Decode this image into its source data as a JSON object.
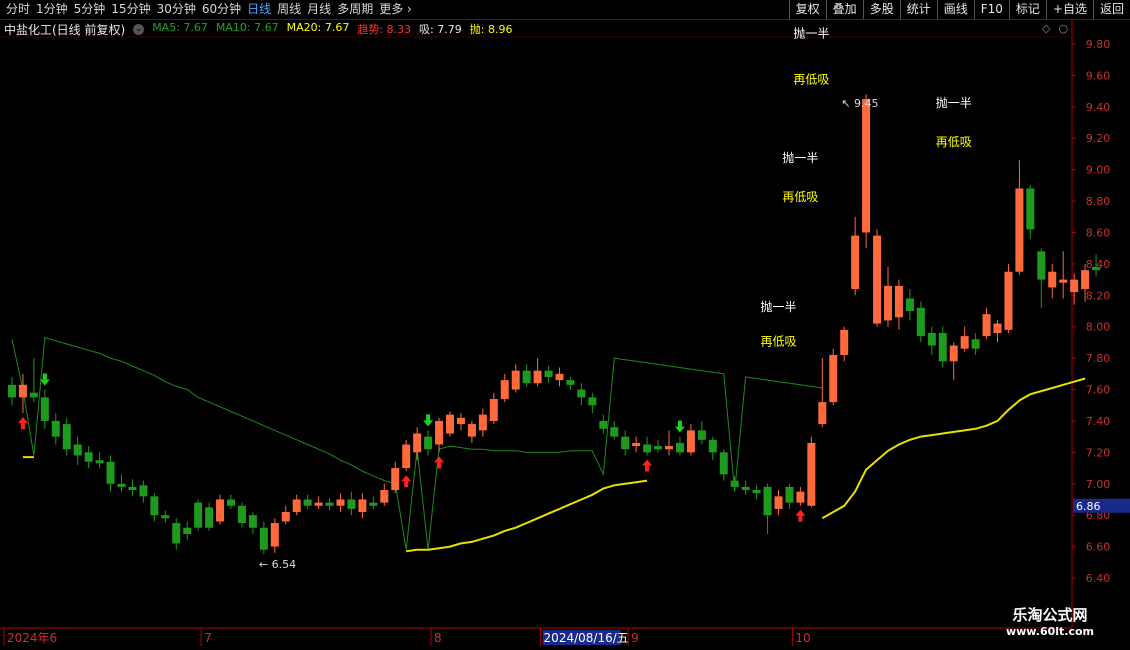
{
  "toolbar": {
    "periods": [
      {
        "label": "分时",
        "active": false
      },
      {
        "label": "1分钟",
        "active": false
      },
      {
        "label": "5分钟",
        "active": false
      },
      {
        "label": "15分钟",
        "active": false
      },
      {
        "label": "30分钟",
        "active": false
      },
      {
        "label": "60分钟",
        "active": false
      },
      {
        "label": "日线",
        "active": true
      },
      {
        "label": "周线",
        "active": false
      },
      {
        "label": "月线",
        "active": false
      },
      {
        "label": "多周期",
        "active": false
      },
      {
        "label": "更多",
        "active": false
      }
    ],
    "right_buttons": [
      "复权",
      "叠加",
      "多股",
      "统计",
      "画线",
      "F10",
      "标记",
      "+自选",
      "返回"
    ]
  },
  "infobar": {
    "title": "中盐化工(日线 前复权)",
    "indicators": [
      {
        "label": "MA5: 7.67",
        "color": "#20a020"
      },
      {
        "label": "MA10: 7.67",
        "color": "#20a020"
      },
      {
        "label": "MA20: 7.67",
        "color": "#ffff00"
      },
      {
        "label": "趋势: 8.33",
        "color": "#ff3030"
      },
      {
        "label": "吸: 7.79",
        "color": "#e8e8e8"
      },
      {
        "label": "抛: 8.96",
        "color": "#ffff00"
      }
    ]
  },
  "colors": {
    "up": "#ff6a3d",
    "down": "#1e9a1e",
    "ma20": "#e8e000",
    "green_line": "#1e8a1e",
    "axis": "#b00000",
    "last_price_bg": "#1a2a8a"
  },
  "chart_data": {
    "type": "candlestick",
    "y_ticks": [
      6.4,
      6.6,
      6.8,
      7.0,
      7.2,
      7.4,
      7.6,
      7.8,
      8.0,
      8.2,
      8.4,
      8.6,
      8.8,
      9.0,
      9.2,
      9.4,
      9.6,
      9.8
    ],
    "ylim": [
      6.3,
      9.9
    ],
    "last_price": "6.86",
    "x_labels": [
      {
        "text": "2024年6",
        "index": 0
      },
      {
        "text": "7",
        "index": 18
      },
      {
        "text": "8",
        "index": 39
      },
      {
        "text": "2024/08/16/五",
        "index": 49,
        "highlight": true
      },
      {
        "text": "9",
        "index": 57
      },
      {
        "text": "10",
        "index": 72
      }
    ],
    "candles": [
      {
        "o": 7.63,
        "c": 7.55,
        "h": 7.68,
        "l": 7.5
      },
      {
        "o": 7.55,
        "c": 7.63,
        "h": 7.7,
        "l": 7.45
      },
      {
        "o": 7.58,
        "c": 7.55,
        "h": 7.8,
        "l": 7.52
      },
      {
        "o": 7.55,
        "c": 7.4,
        "h": 7.6,
        "l": 7.35
      },
      {
        "o": 7.4,
        "c": 7.3,
        "h": 7.45,
        "l": 7.25
      },
      {
        "o": 7.38,
        "c": 7.22,
        "h": 7.42,
        "l": 7.18
      },
      {
        "o": 7.25,
        "c": 7.18,
        "h": 7.3,
        "l": 7.12
      },
      {
        "o": 7.2,
        "c": 7.14,
        "h": 7.24,
        "l": 7.1
      },
      {
        "o": 7.15,
        "c": 7.13,
        "h": 7.2,
        "l": 7.1
      },
      {
        "o": 7.14,
        "c": 7.0,
        "h": 7.18,
        "l": 6.95
      },
      {
        "o": 7.0,
        "c": 6.98,
        "h": 7.06,
        "l": 6.95
      },
      {
        "o": 6.98,
        "c": 6.96,
        "h": 7.03,
        "l": 6.92
      },
      {
        "o": 6.99,
        "c": 6.92,
        "h": 7.02,
        "l": 6.88
      },
      {
        "o": 6.92,
        "c": 6.8,
        "h": 6.94,
        "l": 6.76
      },
      {
        "o": 6.8,
        "c": 6.78,
        "h": 6.83,
        "l": 6.75
      },
      {
        "o": 6.75,
        "c": 6.62,
        "h": 6.78,
        "l": 6.58
      },
      {
        "o": 6.72,
        "c": 6.68,
        "h": 6.76,
        "l": 6.64
      },
      {
        "o": 6.88,
        "c": 6.72,
        "h": 6.9,
        "l": 6.7
      },
      {
        "o": 6.85,
        "c": 6.72,
        "h": 6.88,
        "l": 6.7
      },
      {
        "o": 6.76,
        "c": 6.9,
        "h": 6.93,
        "l": 6.74
      },
      {
        "o": 6.9,
        "c": 6.86,
        "h": 6.93,
        "l": 6.84
      },
      {
        "o": 6.86,
        "c": 6.75,
        "h": 6.88,
        "l": 6.72
      },
      {
        "o": 6.8,
        "c": 6.72,
        "h": 6.82,
        "l": 6.68
      },
      {
        "o": 6.72,
        "c": 6.58,
        "h": 6.76,
        "l": 6.55
      },
      {
        "o": 6.6,
        "c": 6.75,
        "h": 6.78,
        "l": 6.56
      },
      {
        "o": 6.76,
        "c": 6.82,
        "h": 6.86,
        "l": 6.74
      },
      {
        "o": 6.82,
        "c": 6.9,
        "h": 6.93,
        "l": 6.8
      },
      {
        "o": 6.9,
        "c": 6.86,
        "h": 6.93,
        "l": 6.84
      },
      {
        "o": 6.86,
        "c": 6.88,
        "h": 6.92,
        "l": 6.84
      },
      {
        "o": 6.88,
        "c": 6.86,
        "h": 6.91,
        "l": 6.83
      },
      {
        "o": 6.86,
        "c": 6.9,
        "h": 6.94,
        "l": 6.82
      },
      {
        "o": 6.9,
        "c": 6.84,
        "h": 6.95,
        "l": 6.8
      },
      {
        "o": 6.82,
        "c": 6.9,
        "h": 6.94,
        "l": 6.78
      },
      {
        "o": 6.88,
        "c": 6.86,
        "h": 6.92,
        "l": 6.84
      },
      {
        "o": 6.88,
        "c": 6.96,
        "h": 7.0,
        "l": 6.86
      },
      {
        "o": 6.96,
        "c": 7.1,
        "h": 7.14,
        "l": 6.94
      },
      {
        "o": 7.1,
        "c": 7.25,
        "h": 7.28,
        "l": 7.08
      },
      {
        "o": 7.2,
        "c": 7.32,
        "h": 7.36,
        "l": 7.15
      },
      {
        "o": 7.3,
        "c": 7.22,
        "h": 7.34,
        "l": 7.18
      },
      {
        "o": 7.25,
        "c": 7.4,
        "h": 7.42,
        "l": 7.2
      },
      {
        "o": 7.32,
        "c": 7.44,
        "h": 7.46,
        "l": 7.3
      },
      {
        "o": 7.38,
        "c": 7.42,
        "h": 7.45,
        "l": 7.34
      },
      {
        "o": 7.3,
        "c": 7.38,
        "h": 7.4,
        "l": 7.26
      },
      {
        "o": 7.34,
        "c": 7.44,
        "h": 7.48,
        "l": 7.3
      },
      {
        "o": 7.4,
        "c": 7.54,
        "h": 7.58,
        "l": 7.38
      },
      {
        "o": 7.54,
        "c": 7.66,
        "h": 7.7,
        "l": 7.52
      },
      {
        "o": 7.6,
        "c": 7.72,
        "h": 7.76,
        "l": 7.58
      },
      {
        "o": 7.72,
        "c": 7.64,
        "h": 7.76,
        "l": 7.62
      },
      {
        "o": 7.64,
        "c": 7.72,
        "h": 7.8,
        "l": 7.62
      },
      {
        "o": 7.72,
        "c": 7.68,
        "h": 7.75,
        "l": 7.64
      },
      {
        "o": 7.66,
        "c": 7.7,
        "h": 7.74,
        "l": 7.62
      },
      {
        "o": 7.66,
        "c": 7.63,
        "h": 7.68,
        "l": 7.6
      },
      {
        "o": 7.6,
        "c": 7.55,
        "h": 7.64,
        "l": 7.5
      },
      {
        "o": 7.55,
        "c": 7.5,
        "h": 7.58,
        "l": 7.45
      },
      {
        "o": 7.4,
        "c": 7.35,
        "h": 7.44,
        "l": 7.32
      },
      {
        "o": 7.36,
        "c": 7.3,
        "h": 7.4,
        "l": 7.28
      },
      {
        "o": 7.3,
        "c": 7.22,
        "h": 7.34,
        "l": 7.18
      },
      {
        "o": 7.24,
        "c": 7.26,
        "h": 7.3,
        "l": 7.2
      },
      {
        "o": 7.25,
        "c": 7.2,
        "h": 7.3,
        "l": 7.18
      },
      {
        "o": 7.24,
        "c": 7.22,
        "h": 7.28,
        "l": 7.2
      },
      {
        "o": 7.22,
        "c": 7.24,
        "h": 7.34,
        "l": 7.18
      },
      {
        "o": 7.26,
        "c": 7.2,
        "h": 7.3,
        "l": 7.18
      },
      {
        "o": 7.2,
        "c": 7.34,
        "h": 7.38,
        "l": 7.18
      },
      {
        "o": 7.34,
        "c": 7.28,
        "h": 7.4,
        "l": 7.25
      },
      {
        "o": 7.28,
        "c": 7.2,
        "h": 7.3,
        "l": 7.15
      },
      {
        "o": 7.2,
        "c": 7.06,
        "h": 7.22,
        "l": 7.02
      },
      {
        "o": 7.02,
        "c": 6.98,
        "h": 7.05,
        "l": 6.95
      },
      {
        "o": 6.98,
        "c": 6.96,
        "h": 7.02,
        "l": 6.93
      },
      {
        "o": 6.96,
        "c": 6.94,
        "h": 6.99,
        "l": 6.9
      },
      {
        "o": 6.98,
        "c": 6.8,
        "h": 7.0,
        "l": 6.68
      },
      {
        "o": 6.84,
        "c": 6.92,
        "h": 6.96,
        "l": 6.8
      },
      {
        "o": 6.98,
        "c": 6.88,
        "h": 7.0,
        "l": 6.84
      },
      {
        "o": 6.88,
        "c": 6.95,
        "h": 6.98,
        "l": 6.86
      },
      {
        "o": 6.86,
        "c": 7.26,
        "h": 7.3,
        "l": 6.85
      },
      {
        "o": 7.38,
        "c": 7.52,
        "h": 7.8,
        "l": 7.36
      },
      {
        "o": 7.52,
        "c": 7.82,
        "h": 7.86,
        "l": 7.5
      },
      {
        "o": 7.82,
        "c": 7.98,
        "h": 8.0,
        "l": 7.78
      },
      {
        "o": 8.24,
        "c": 8.58,
        "h": 8.7,
        "l": 8.2
      },
      {
        "o": 8.6,
        "c": 9.45,
        "h": 9.48,
        "l": 8.5
      },
      {
        "o": 8.02,
        "c": 8.58,
        "h": 8.62,
        "l": 8.0
      },
      {
        "o": 8.04,
        "c": 8.26,
        "h": 8.38,
        "l": 8.0
      },
      {
        "o": 8.06,
        "c": 8.26,
        "h": 8.3,
        "l": 7.98
      },
      {
        "o": 8.18,
        "c": 8.1,
        "h": 8.24,
        "l": 8.04
      },
      {
        "o": 8.12,
        "c": 7.94,
        "h": 8.16,
        "l": 7.9
      },
      {
        "o": 7.96,
        "c": 7.88,
        "h": 8.0,
        "l": 7.82
      },
      {
        "o": 7.96,
        "c": 7.78,
        "h": 8.0,
        "l": 7.74
      },
      {
        "o": 7.78,
        "c": 7.88,
        "h": 7.9,
        "l": 7.66
      },
      {
        "o": 7.86,
        "c": 7.94,
        "h": 8.0,
        "l": 7.84
      },
      {
        "o": 7.92,
        "c": 7.86,
        "h": 7.96,
        "l": 7.82
      },
      {
        "o": 7.94,
        "c": 8.08,
        "h": 8.12,
        "l": 7.92
      },
      {
        "o": 7.96,
        "c": 8.02,
        "h": 8.04,
        "l": 7.9
      },
      {
        "o": 7.98,
        "c": 8.35,
        "h": 8.4,
        "l": 7.96
      },
      {
        "o": 8.35,
        "c": 8.88,
        "h": 9.06,
        "l": 8.33
      },
      {
        "o": 8.88,
        "c": 8.62,
        "h": 8.9,
        "l": 8.56
      },
      {
        "o": 8.48,
        "c": 8.3,
        "h": 8.5,
        "l": 8.12
      },
      {
        "o": 8.25,
        "c": 8.35,
        "h": 8.4,
        "l": 8.18
      },
      {
        "o": 8.28,
        "c": 8.3,
        "h": 8.48,
        "l": 8.18
      },
      {
        "o": 8.22,
        "c": 8.3,
        "h": 8.34,
        "l": 8.14
      },
      {
        "o": 8.24,
        "c": 8.36,
        "h": 8.4,
        "l": 8.16
      },
      {
        "o": 8.38,
        "c": 8.36,
        "h": 8.46,
        "l": 8.32
      }
    ],
    "green_line": [
      7.92,
      7.6,
      7.18,
      7.93,
      7.91,
      7.89,
      7.87,
      7.85,
      7.83,
      7.8,
      7.78,
      7.75,
      7.72,
      7.69,
      7.65,
      7.62,
      7.6,
      7.55,
      7.52,
      7.49,
      7.46,
      7.43,
      7.4,
      7.37,
      7.34,
      7.31,
      7.28,
      7.25,
      7.22,
      7.19,
      7.15,
      7.12,
      7.08,
      7.05,
      7.02,
      7.0,
      6.58,
      7.22,
      6.58,
      7.22,
      7.24,
      7.23,
      7.22,
      7.22,
      7.21,
      7.21,
      7.21,
      7.2,
      7.2,
      7.2,
      7.2,
      7.21,
      7.21,
      7.21,
      7.06,
      7.8,
      7.79,
      7.78,
      7.77,
      7.76,
      7.75,
      7.74,
      7.73,
      7.72,
      7.71,
      7.7,
      6.95,
      7.68,
      7.67,
      7.66,
      7.65,
      7.64,
      7.63,
      7.62,
      7.61
    ],
    "ma20": [
      null,
      7.17,
      7.17,
      null,
      null,
      null,
      null,
      null,
      null,
      null,
      null,
      null,
      null,
      null,
      null,
      null,
      null,
      null,
      null,
      null,
      null,
      null,
      null,
      null,
      null,
      null,
      null,
      null,
      null,
      null,
      null,
      null,
      null,
      null,
      null,
      null,
      6.57,
      6.58,
      6.58,
      6.59,
      6.6,
      6.62,
      6.63,
      6.65,
      6.67,
      6.7,
      6.72,
      6.75,
      6.78,
      6.81,
      6.84,
      6.87,
      6.9,
      6.93,
      6.97,
      6.99,
      7.0,
      7.01,
      7.02,
      null,
      null,
      6.96,
      null,
      null,
      null,
      null,
      null,
      null,
      null,
      null,
      null,
      null,
      null,
      null,
      6.78,
      6.82,
      6.86,
      6.95,
      7.09,
      7.15,
      7.21,
      7.25,
      7.28,
      7.3,
      7.31,
      7.32,
      7.33,
      7.34,
      7.35,
      7.37,
      7.4,
      7.47,
      7.53,
      7.57,
      7.59,
      7.61,
      7.63,
      7.65,
      7.67
    ],
    "red_arrows": [
      1,
      36,
      39,
      58,
      72
    ],
    "green_arrows": [
      3,
      38,
      61
    ],
    "extreme_labels": [
      {
        "text": "9.45",
        "index": 75,
        "price": 9.45
      },
      {
        "text": "6.54",
        "index": 22,
        "price": 6.54
      }
    ],
    "signal_labels": [
      {
        "text": "抛一半",
        "color": "#ffffff",
        "index": 73,
        "price": 9.84
      },
      {
        "text": "再低吸",
        "color": "#ffff00",
        "index": 73,
        "price": 9.55
      },
      {
        "text": "抛一半",
        "color": "#ffffff",
        "index": 72,
        "price": 9.05
      },
      {
        "text": "再低吸",
        "color": "#ffff00",
        "index": 72,
        "price": 8.8
      },
      {
        "text": "抛一半",
        "color": "#ffffff",
        "index": 70,
        "price": 8.1
      },
      {
        "text": "再低吸",
        "color": "#ffff00",
        "index": 70,
        "price": 7.88
      },
      {
        "text": "抛一半",
        "color": "#ffffff",
        "index": 86,
        "price": 9.4
      },
      {
        "text": "再低吸",
        "color": "#ffff00",
        "index": 86,
        "price": 9.15
      }
    ]
  },
  "watermark": {
    "line1": "乐淘公式网",
    "line2": "www.60lt.com"
  }
}
